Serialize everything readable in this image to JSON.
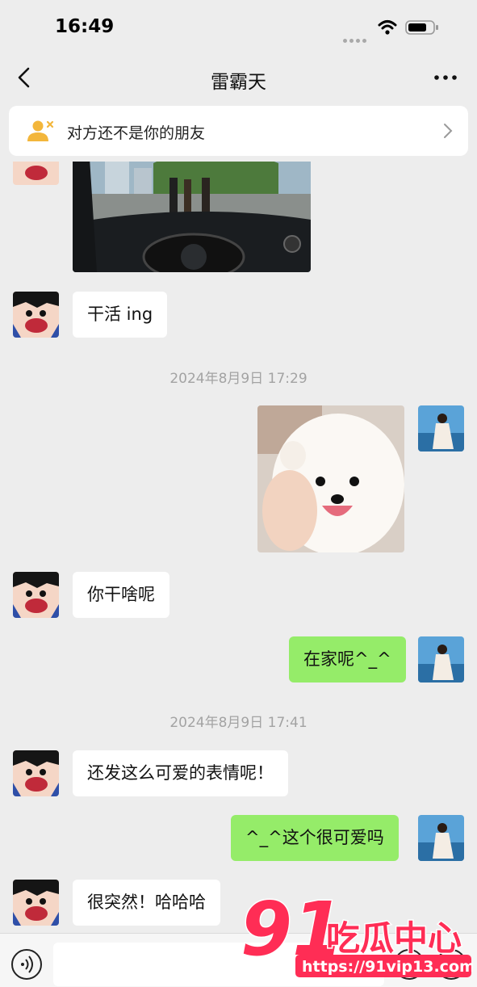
{
  "status_bar": {
    "time": "16:49"
  },
  "navbar": {
    "title": "雷霸天"
  },
  "friend_banner": {
    "text": "对方还不是你的朋友"
  },
  "messages": {
    "m1": "干活 ing",
    "m2": "你干啥呢",
    "m3": "在家呢^_^",
    "m4": "还发这么可爱的表情呢！",
    "m5": "^_^这个很可爱吗",
    "m6": "很突然！哈哈哈"
  },
  "timestamps": {
    "t1": "2024年8月9日 17:29",
    "t2": "2024年8月9日 17:41"
  },
  "watermark": {
    "brand_number": "91",
    "brand_text": "吃瓜中心",
    "url": "https://91vip13.com"
  },
  "colors": {
    "sent_bubble": "#95ec69",
    "received_bubble": "#ffffff",
    "background": "#ededed",
    "watermark": "#ff2d55"
  },
  "icons": [
    "signal-icon",
    "wifi-icon",
    "battery-icon",
    "back-arrow-icon",
    "more-icon",
    "person-x-icon",
    "chevron-right-icon",
    "voice-icon",
    "emoji-icon",
    "plus-icon"
  ]
}
